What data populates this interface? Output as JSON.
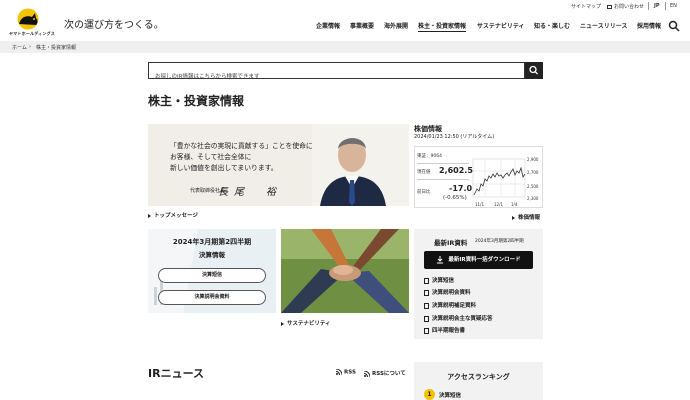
{
  "header": {
    "logo_text": "ヤマトホールディングス",
    "tagline": "次の運び方をつくる。",
    "utility": {
      "sitemap": "サイトマップ",
      "contact": "お問い合わせ",
      "lang_jp": "JP",
      "lang_en": "EN"
    },
    "nav": [
      {
        "label": "企業情報"
      },
      {
        "label": "事業概要"
      },
      {
        "label": "海外展開"
      },
      {
        "label": "株主・投資家情報",
        "active": true
      },
      {
        "label": "サステナビリティ"
      },
      {
        "label": "知る・楽しむ"
      },
      {
        "label": "ニュースリリース"
      },
      {
        "label": "採用情報"
      }
    ],
    "search_icon": "search-icon"
  },
  "breadcrumb": [
    "ホーム",
    "株主・投資家情報"
  ],
  "search": {
    "placeholder": "お探しのIR情報はこちらから検索できます"
  },
  "page_title": "株主・投資家情報",
  "message": {
    "lines": [
      "「豊かな社会の実現に貢献する」ことを使命に、",
      "お客様、そして社会全体に",
      "新しい価値を創出してまいります。"
    ],
    "role": "代表取締役社長",
    "name": "長尾　裕",
    "link": "トップメッセージ"
  },
  "stock": {
    "title": "株価情報",
    "timestamp": "2024/01/23 12:50 (リアルタイム)",
    "code_label": "東証：9064",
    "price_label": "現在値",
    "price": "2,602.5",
    "change_label": "前日比",
    "change": "-17.0",
    "change_pct": "(-0.65%)",
    "chart_y_ticks": [
      "2,900",
      "2,700",
      "2,500",
      "2,300"
    ],
    "chart_x_ticks": [
      "11/1",
      "12/1",
      "1/4"
    ],
    "link": "株価情報"
  },
  "results_card": {
    "title": "2024年3月期第2四半期",
    "subtitle": "決算情報",
    "buttons": [
      "決算短信",
      "決算説明会資料"
    ]
  },
  "sustainability": {
    "link": "サステナビリティ"
  },
  "ir_docs": {
    "title": "最新IR資料",
    "period": "2024年3月期第2四半期",
    "download_label": "最新IR資料一括ダウンロード",
    "items": [
      "決算短信",
      "決算説明会資料",
      "決算説明補足資料",
      "決算説明会主な質疑応答",
      "四半期報告書"
    ]
  },
  "news": {
    "title": "IRニュース",
    "rss": "RSS",
    "rss_about": "RSSについて"
  },
  "ranking": {
    "title": "アクセスランキング",
    "items": [
      {
        "rank": "1",
        "label": "決算短信"
      }
    ]
  },
  "colors": {
    "accent": "#f3c300",
    "dark": "#222222",
    "panel": "#f2f2f2"
  }
}
